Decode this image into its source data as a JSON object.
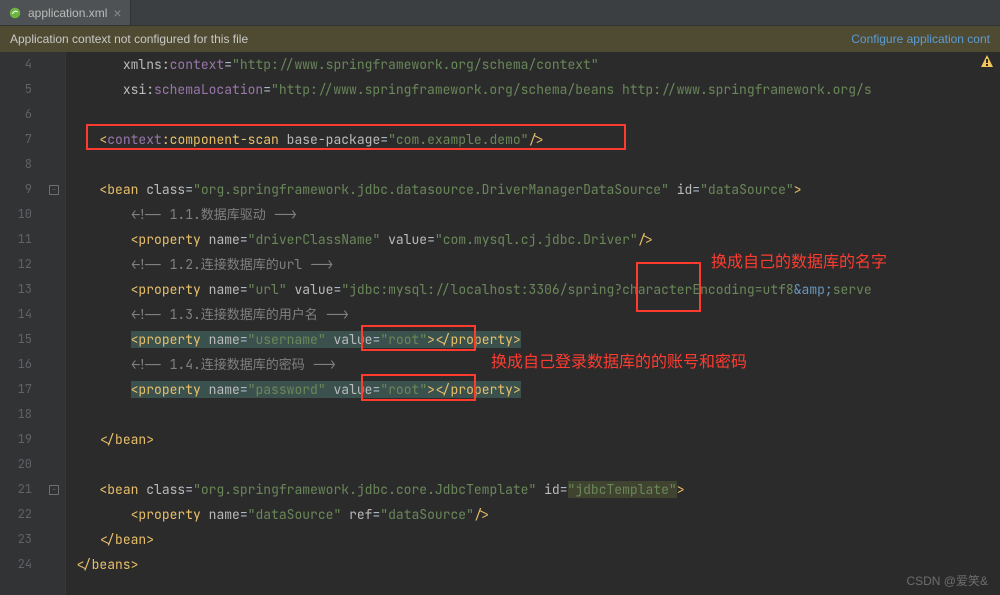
{
  "tab": {
    "filename": "application.xml",
    "close": "×"
  },
  "notice": {
    "text": "Application context not configured for this file",
    "link": "Configure application cont"
  },
  "watermark": "CSDN @爱笑&",
  "annotations": {
    "db_name": "换成自己的数据库的名字",
    "creds": "换成自己登录数据库的的账号和密码"
  },
  "gutter": [
    "4",
    "5",
    "6",
    "7",
    "8",
    "9",
    "10",
    "11",
    "12",
    "13",
    "14",
    "15",
    "16",
    "17",
    "18",
    "19",
    "20",
    "21",
    "22",
    "23",
    "24"
  ],
  "code": {
    "l4": {
      "prefix": "xmlns:",
      "ns": "context",
      "eq": "=",
      "val": "\"http://www.springframework.org/schema/context\""
    },
    "l5": {
      "prefix": "xsi:",
      "attr": "schemaLocation",
      "eq": "=",
      "val": "\"http://www.springframework.org/schema/beans http://www.springframework.org/s"
    },
    "l7": {
      "open": "<",
      "ns": "context",
      "colon": ":",
      "el": "component-scan",
      "sp": " ",
      "attr": "base-package",
      "eq": "=",
      "val": "\"com.example.demo\"",
      "close": "/>"
    },
    "l9": {
      "open": "<",
      "el": "bean",
      "a1": "class",
      "v1": "\"org.springframework.jdbc.datasource.DriverManagerDataSource\"",
      "a2": "id",
      "v2": "\"dataSource\"",
      "close": ">"
    },
    "l10": {
      "com": "<!-- 1.1.数据库驱动 -->"
    },
    "l11": {
      "open": "<",
      "el": "property",
      "a1": "name",
      "v1": "\"driverClassName\"",
      "a2": "value",
      "v2": "\"com.mysql.cj.jdbc.Driver\"",
      "close": "/>"
    },
    "l12": {
      "com": "<!-- 1.2.连接数据库的url -->"
    },
    "l13": {
      "open": "<",
      "el": "property",
      "a1": "name",
      "v1": "\"url\"",
      "a2": "value",
      "v2a": "\"jdbc:mysql://localhost:3306/spring?characterEncoding=utf8",
      "amp": "&amp;",
      "v2b": "serve"
    },
    "l14": {
      "com": "<!-- 1.3.连接数据库的用户名 -->"
    },
    "l15": {
      "open": "<",
      "el": "property",
      "a1": "name",
      "v1": "\"username\"",
      "a2": "value",
      "v2": "\"root\"",
      "mid": ">",
      "close_open": "</",
      "close_el": "property",
      "close": ">"
    },
    "l16": {
      "com": "<!-- 1.4.连接数据库的密码 -->"
    },
    "l17": {
      "open": "<",
      "el": "property",
      "a1": "name",
      "v1": "\"password\"",
      "a2": "value",
      "v2": "\"root\"",
      "mid": ">",
      "close_open": "</",
      "close_el": "property",
      "close": ">"
    },
    "l19": {
      "open": "</",
      "el": "bean",
      "close": ">"
    },
    "l21": {
      "open": "<",
      "el": "bean",
      "a1": "class",
      "v1": "\"org.springframework.jdbc.core.JdbcTemplate\"",
      "a2": "id",
      "v2": "\"jdbcTemplate\"",
      "close": ">"
    },
    "l22": {
      "open": "<",
      "el": "property",
      "a1": "name",
      "v1": "\"dataSource\"",
      "a2": "ref",
      "v2": "\"dataSource\"",
      "close": "/>"
    },
    "l23": {
      "open": "</",
      "el": "bean",
      "close": ">"
    },
    "l24": {
      "open": "</",
      "el": "beans",
      "close": ">"
    }
  }
}
